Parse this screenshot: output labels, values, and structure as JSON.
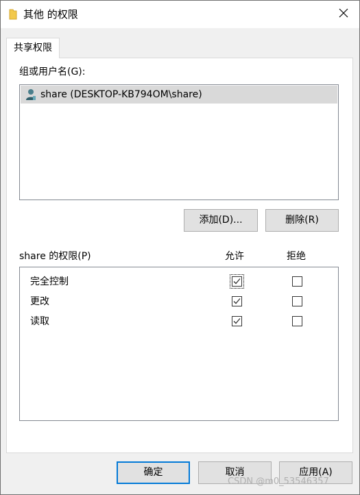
{
  "window": {
    "title": "其他 的权限",
    "icon": "folder-icon",
    "close_icon": "close-icon"
  },
  "tabs": [
    {
      "label": "共享权限",
      "active": true
    }
  ],
  "groups": {
    "label": "组或用户名(G):",
    "users": [
      {
        "name": "share (DESKTOP-KB794OM\\share)",
        "icon": "user-icon",
        "selected": true
      }
    ]
  },
  "group_buttons": {
    "add": "添加(D)...",
    "remove": "删除(R)"
  },
  "permissions": {
    "label": "share 的权限(P)",
    "allow_header": "允许",
    "deny_header": "拒绝",
    "rows": [
      {
        "name": "完全控制",
        "allow": true,
        "deny": false
      },
      {
        "name": "更改",
        "allow": true,
        "deny": false
      },
      {
        "name": "读取",
        "allow": true,
        "deny": false
      }
    ]
  },
  "footer": {
    "ok": "确定",
    "cancel": "取消",
    "apply": "应用(A)"
  },
  "watermark": "CSDN @m0_53546357",
  "colors": {
    "selection": "#d9d9d9",
    "default_button_border": "#0078d7",
    "button_face": "#e1e1e1",
    "dialog_bg": "#f0f0f0"
  }
}
